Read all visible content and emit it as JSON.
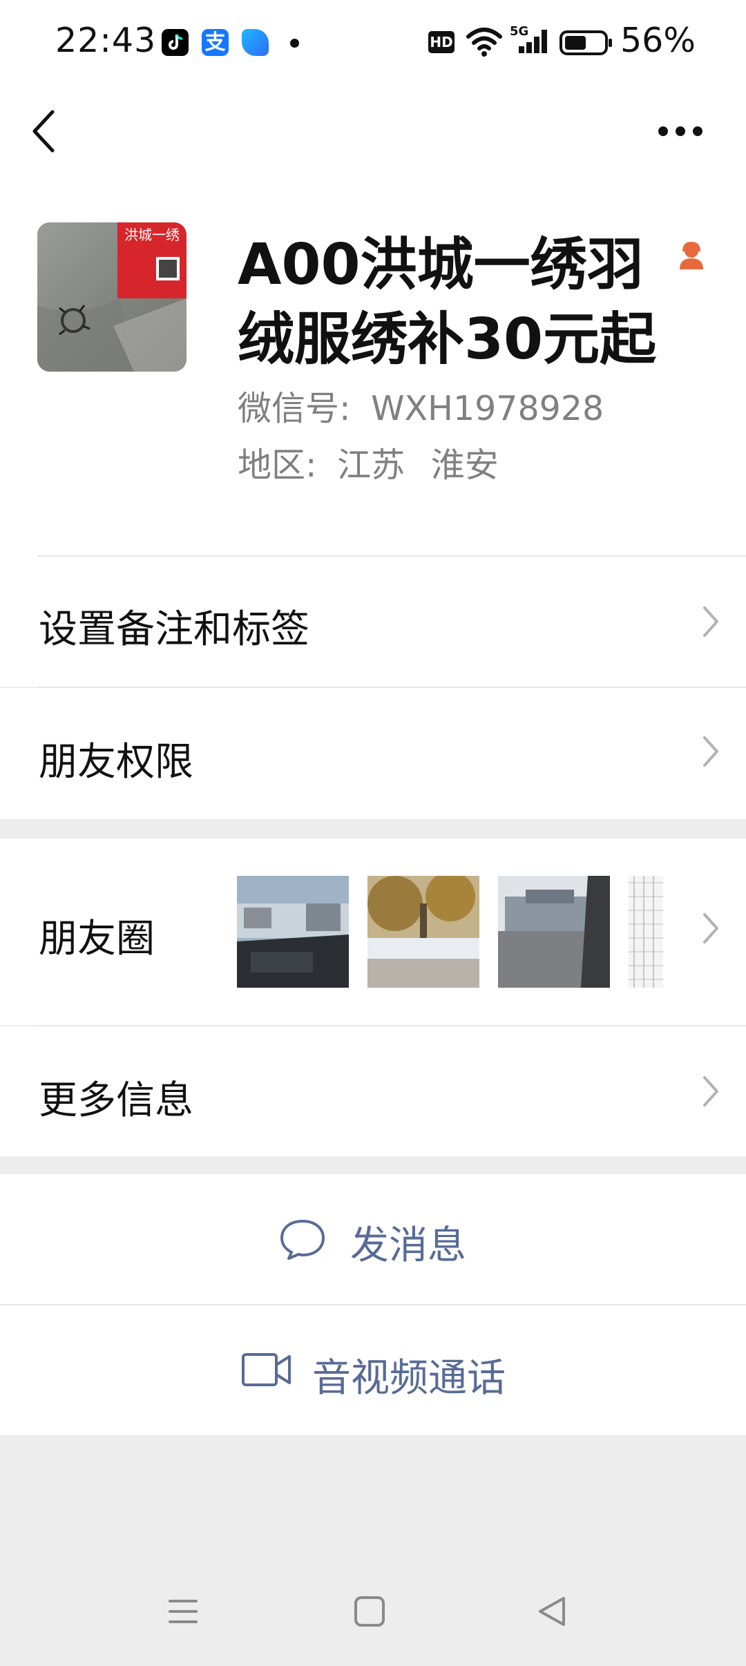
{
  "status_bar": {
    "time": "22:43",
    "alipay_glyph": "支",
    "hd_label": "HD",
    "network": "5G",
    "battery": "56%",
    "icons": [
      "tiktok-icon",
      "alipay-icon",
      "app-icon",
      "notification-dot",
      "hd-icon",
      "wifi-icon",
      "signal-5g-icon",
      "battery-icon"
    ]
  },
  "nav": {
    "back_icon": "chevron-left-icon",
    "more_icon": "more-dots-icon"
  },
  "profile": {
    "nickname": "A00洪城一绣羽绒服绣补30元起",
    "wechat_id_label": "微信号:",
    "wechat_id": "WXH1978928",
    "region_label": "地区:",
    "region_province": "江苏",
    "region_city": "淮安",
    "avatar_text": "洪城一绣",
    "verified_icon": "female-person-icon",
    "accent_color": "#e86a3c"
  },
  "rows": {
    "remark_label": "设置备注和标签",
    "permission_label": "朋友权限",
    "moments_label": "朋友圈",
    "more_info_label": "更多信息"
  },
  "actions": {
    "message_label": "发消息",
    "call_label": "音视频通话",
    "link_color": "#576b95"
  }
}
